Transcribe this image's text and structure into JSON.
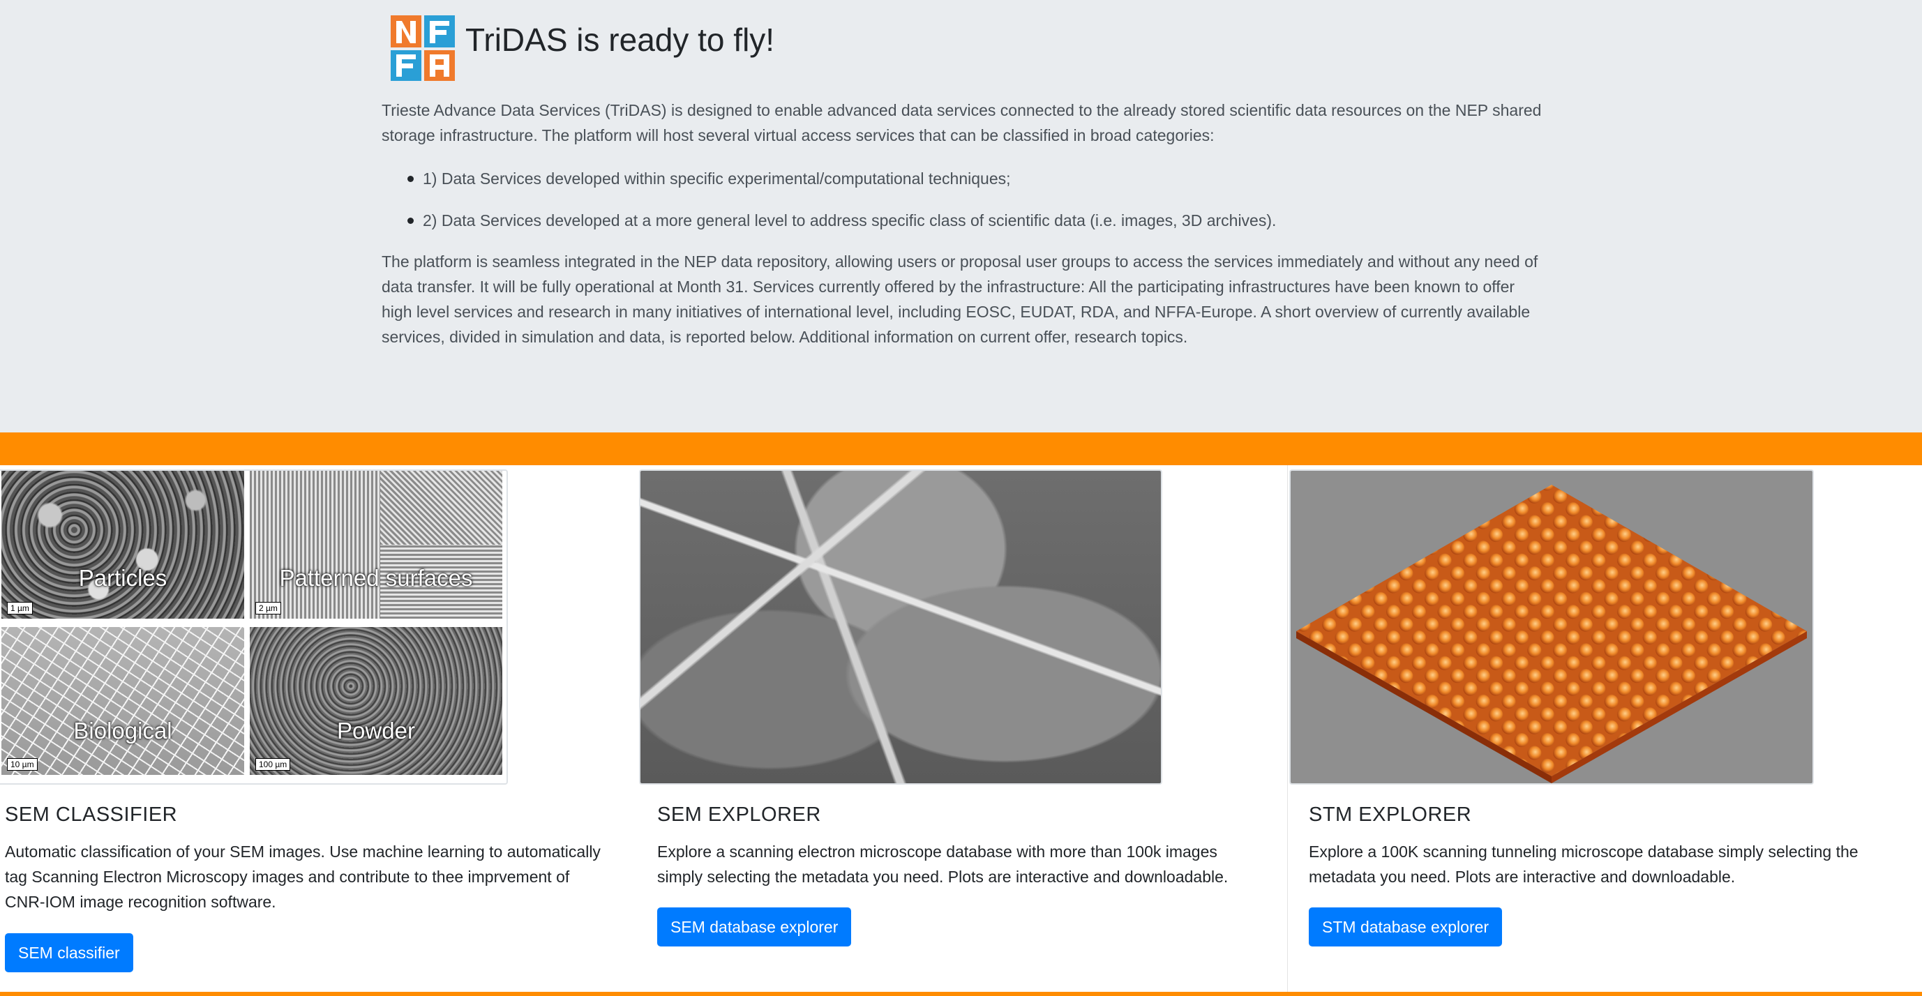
{
  "header": {
    "title": "TriDAS is ready to fly!",
    "logo_letters": [
      "N",
      "F",
      "F",
      "A"
    ],
    "intro": "Trieste Advance Data Services (TriDAS) is designed to enable advanced data services connected to the already stored scientific data resources on the NEP shared storage infrastructure. The platform will host several virtual access services that can be classified in broad categories:",
    "bullets": [
      "1) Data Services developed within specific experimental/computational techniques;",
      "2) Data Services developed at a more general level to address specific class of scientific data (i.e. images, 3D archives)."
    ],
    "body": "The platform is seamless integrated in the NEP data repository, allowing users or proposal user groups to access the services immediately and without any need of data transfer. It will be fully operational at Month 31. Services currently offered by the infrastructure: All the participating infrastructures have been known to offer high level services and research in many initiatives of international level, including EOSC, EUDAT, RDA, and NFFA-Europe. A short overview of currently available services, divided in simulation and data, is reported below. Additional information on current offer, research topics."
  },
  "colors": {
    "jumbotron_bg": "#e9ecef",
    "band": "#ff8c00",
    "button": "#007bff",
    "logo_orange": "#f07a2c",
    "logo_blue": "#2a9fd6"
  },
  "cards": [
    {
      "title": "SEM CLASSIFIER",
      "text": "Automatic classification of your SEM images. Use machine learning to automatically tag Scanning Electron Microscopy images and contribute to thee imprvement of CNR-IOM image recognition software.",
      "button": "SEM classifier",
      "image_tiles": [
        {
          "label": "Particles",
          "scale": "1 µm"
        },
        {
          "label": "Patterned surfaces",
          "scale": "2 µm"
        },
        {
          "label": "Biological",
          "scale": "10 µm"
        },
        {
          "label": "Powder",
          "scale": "100 µm"
        }
      ]
    },
    {
      "title": "SEM EXPLORER",
      "text": "Explore a scanning electron microscope database with more than 100k images simply selecting the metadata you need. Plots are interactive and downloadable.",
      "button": "SEM database explorer"
    },
    {
      "title": "STM EXPLORER",
      "text": "Explore a 100K scanning tunneling microscope database simply selecting the metadata you need. Plots are interactive and downloadable.",
      "button": "STM database explorer"
    }
  ]
}
